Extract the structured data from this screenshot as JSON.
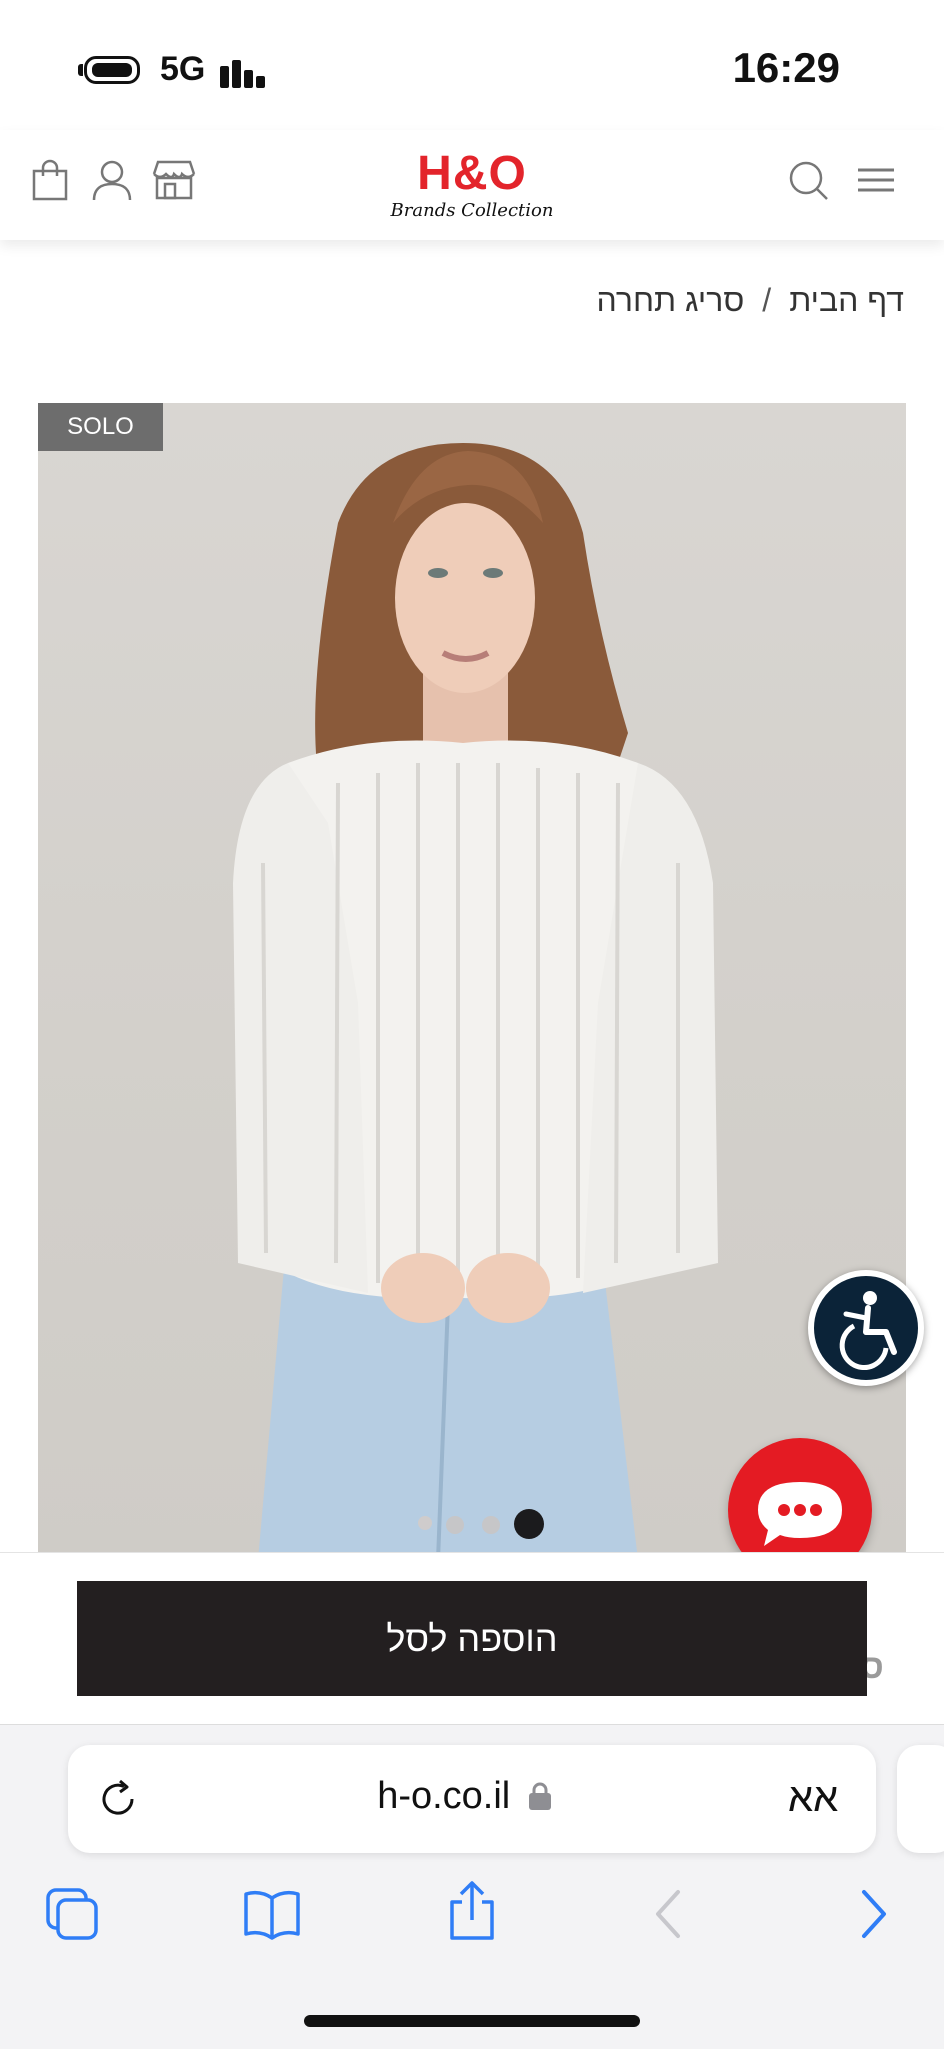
{
  "status_bar": {
    "network": "5G",
    "time": "16:29"
  },
  "header": {
    "logo_main": "H&O",
    "logo_sub": "Brands Collection",
    "icons": [
      "bag-icon",
      "user-icon",
      "store-icon",
      "search-icon",
      "menu-icon"
    ]
  },
  "breadcrumb": {
    "home": "דף הבית",
    "separator": "/",
    "current": "סריג תחרה"
  },
  "product": {
    "badge": "SOLO",
    "gallery_count": 4,
    "gallery_active_index": 3
  },
  "cart": {
    "add_label": "הוספה לסל",
    "peek_text": "ס"
  },
  "browser": {
    "url": "h-o.co.il",
    "text_size_label": "אא"
  },
  "colors": {
    "brand_red": "#e3242b",
    "button_dark": "#231f20",
    "a11y_navy": "#0b2338",
    "ios_blue": "#2f7df6"
  }
}
